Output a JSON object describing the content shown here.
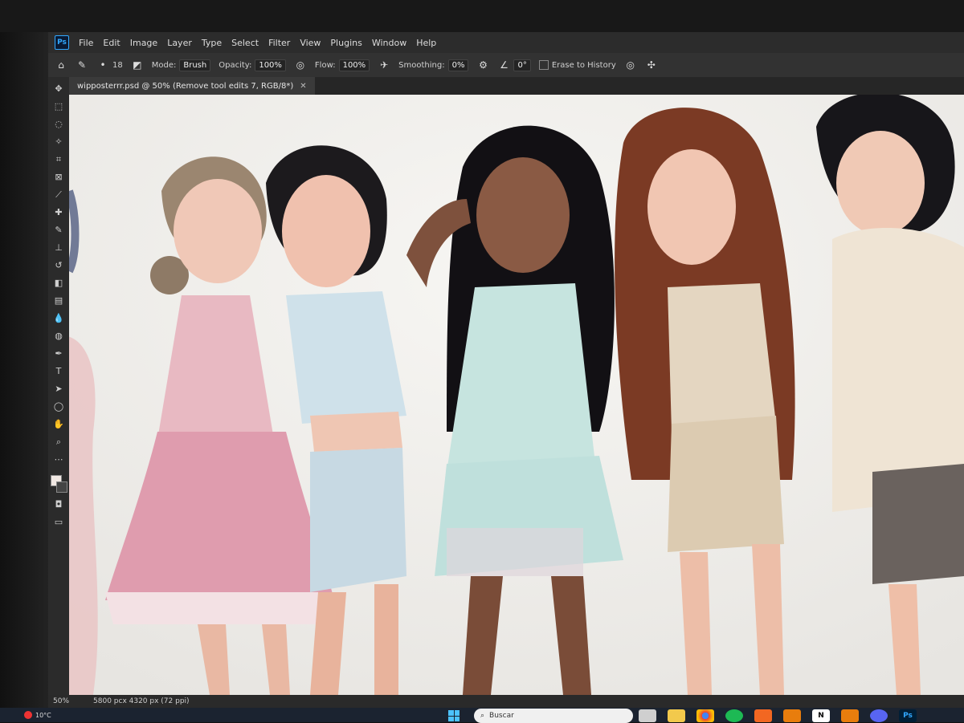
{
  "menubar": {
    "items": [
      "File",
      "Edit",
      "Image",
      "Layer",
      "Type",
      "Select",
      "Filter",
      "View",
      "Plugins",
      "Window",
      "Help"
    ]
  },
  "options": {
    "brush_size": "18",
    "mode_label": "Mode:",
    "mode_value": "Brush",
    "opacity_label": "Opacity:",
    "opacity_value": "100%",
    "flow_label": "Flow:",
    "flow_value": "100%",
    "smoothing_label": "Smoothing:",
    "smoothing_value": "0%",
    "angle_value": "0°",
    "erase_history_label": "Erase to History"
  },
  "document": {
    "tab_title": "wipposterrr.psd @ 50% (Remove tool edits 7, RGB/8*)"
  },
  "status": {
    "zoom": "50%",
    "dimensions": "5800 pcx 4320 px (72 ppi)"
  },
  "taskbar": {
    "weather_temp": "10°C",
    "search_placeholder": "Buscar",
    "icons": [
      "file-explorer-icon",
      "folder-icon",
      "chrome-icon",
      "spotify-icon",
      "brave-icon",
      "blender-icon",
      "notion-icon",
      "blender-icon",
      "discord-icon",
      "photoshop-icon"
    ]
  },
  "colors": {
    "accent": "#31a8ff",
    "canvas_bg": "#f3f2ef",
    "panel_bg": "#2c2c2c"
  }
}
